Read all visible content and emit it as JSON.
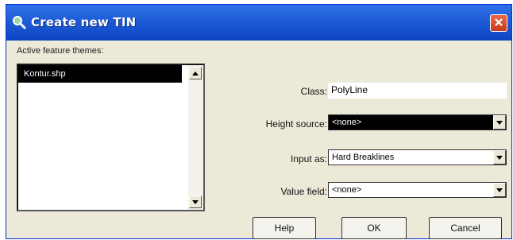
{
  "window": {
    "title": "Create new TIN",
    "close_icon": "close-icon"
  },
  "themes": {
    "label": "Active feature themes:",
    "items": [
      "Kontur.shp"
    ],
    "selected_index": 0
  },
  "form": {
    "class_label": "Class:",
    "class_value": "PolyLine",
    "height_source_label": "Height source:",
    "height_source_value": "<none>",
    "input_as_label": "Input as:",
    "input_as_value": "Hard Breaklines",
    "value_field_label": "Value field:",
    "value_field_value": "<none>"
  },
  "buttons": {
    "help": "Help",
    "ok": "OK",
    "cancel": "Cancel"
  },
  "colors": {
    "titlebar": "#1f5bd7",
    "close": "#c93a1c",
    "dialog_bg": "#ece9d8"
  }
}
